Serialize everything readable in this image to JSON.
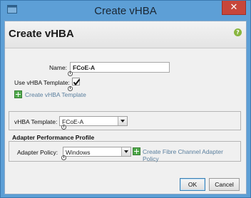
{
  "window": {
    "title": "Create vHBA",
    "close_label": "✕"
  },
  "dialog": {
    "header": "Create vHBA",
    "help_icon": "?"
  },
  "form": {
    "name_label": "Name:",
    "name_value": "FCoE-A",
    "use_template_label": "Use vHBA Template:",
    "use_template_checked": true,
    "create_template_link": "Create vHBA Template",
    "template_label": "vHBA Template:",
    "template_value": "FCoE-A"
  },
  "adapter_profile": {
    "title": "Adapter Performance Profile",
    "policy_label": "Adapter Policy:",
    "policy_value": "Windows",
    "create_policy_link": "Create Fibre Channel Adapter Policy"
  },
  "buttons": {
    "ok": "OK",
    "cancel": "Cancel"
  },
  "colors": {
    "titlebar": "#5d9fd6",
    "close": "#c7463a",
    "add_icon": "#4ea84a",
    "link": "#5a7f9e"
  }
}
